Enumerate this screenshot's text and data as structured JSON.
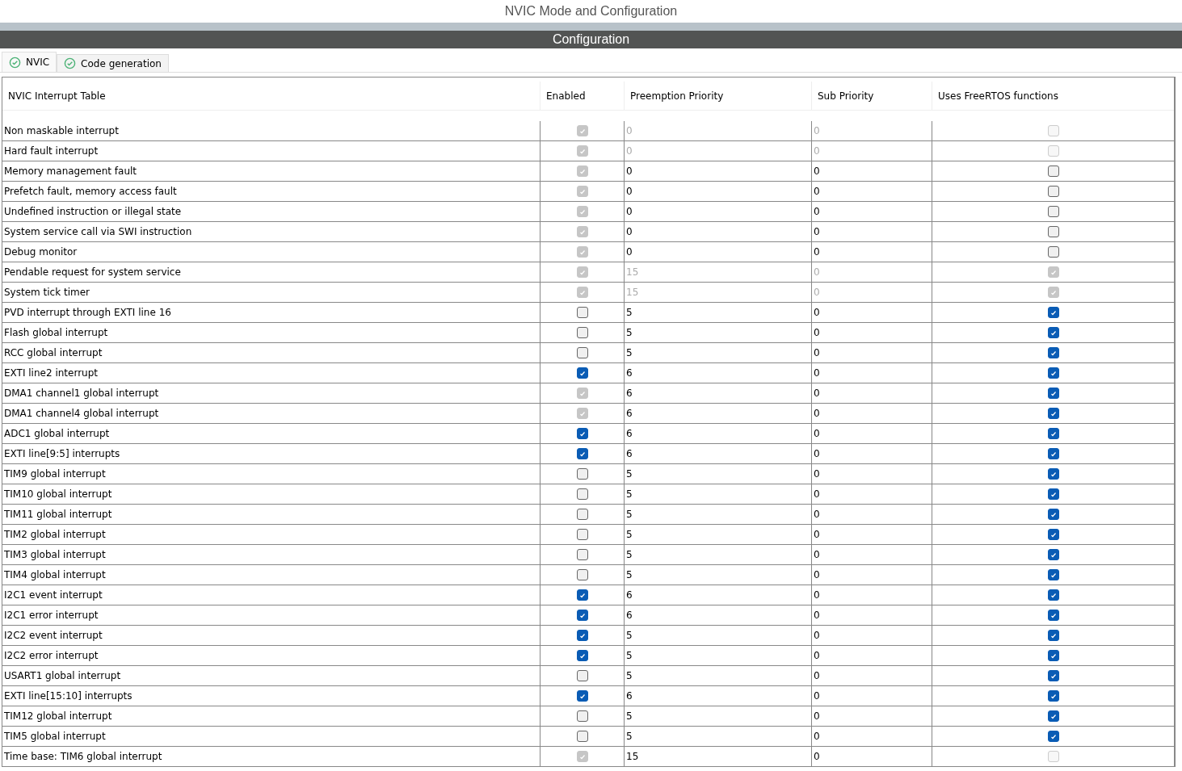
{
  "window": {
    "title": "NVIC Mode and Configuration"
  },
  "section": {
    "title": "Configuration"
  },
  "tabs": [
    {
      "label": "NVIC",
      "selected": true
    },
    {
      "label": "Code generation",
      "selected": false
    }
  ],
  "table": {
    "columns": [
      "NVIC Interrupt Table",
      "Enabled",
      "Preemption Priority",
      "Sub Priority",
      "Uses FreeRTOS functions"
    ],
    "rows": [
      {
        "name": "Non maskable interrupt",
        "enabled": {
          "checked": true,
          "disabled": true
        },
        "preemption": "0",
        "sub": "0",
        "priorities_disabled": true,
        "freertos": {
          "checked": false,
          "disabled": true
        }
      },
      {
        "name": "Hard fault interrupt",
        "enabled": {
          "checked": true,
          "disabled": true
        },
        "preemption": "0",
        "sub": "0",
        "priorities_disabled": true,
        "freertos": {
          "checked": false,
          "disabled": true
        }
      },
      {
        "name": "Memory management fault",
        "enabled": {
          "checked": true,
          "disabled": true
        },
        "preemption": "0",
        "sub": "0",
        "priorities_disabled": false,
        "freertos": {
          "checked": false,
          "disabled": false
        }
      },
      {
        "name": "Prefetch fault, memory access fault",
        "enabled": {
          "checked": true,
          "disabled": true
        },
        "preemption": "0",
        "sub": "0",
        "priorities_disabled": false,
        "freertos": {
          "checked": false,
          "disabled": false
        }
      },
      {
        "name": "Undefined instruction or illegal state",
        "enabled": {
          "checked": true,
          "disabled": true
        },
        "preemption": "0",
        "sub": "0",
        "priorities_disabled": false,
        "freertos": {
          "checked": false,
          "disabled": false
        }
      },
      {
        "name": "System service call via SWI instruction",
        "enabled": {
          "checked": true,
          "disabled": true
        },
        "preemption": "0",
        "sub": "0",
        "priorities_disabled": false,
        "freertos": {
          "checked": false,
          "disabled": false
        }
      },
      {
        "name": "Debug monitor",
        "enabled": {
          "checked": true,
          "disabled": true
        },
        "preemption": "0",
        "sub": "0",
        "priorities_disabled": false,
        "freertos": {
          "checked": false,
          "disabled": false
        }
      },
      {
        "name": "Pendable request for system service",
        "enabled": {
          "checked": true,
          "disabled": true
        },
        "preemption": "15",
        "sub": "0",
        "priorities_disabled": true,
        "freertos": {
          "checked": true,
          "disabled": true
        }
      },
      {
        "name": "System tick timer",
        "enabled": {
          "checked": true,
          "disabled": true
        },
        "preemption": "15",
        "sub": "0",
        "priorities_disabled": true,
        "freertos": {
          "checked": true,
          "disabled": true
        }
      },
      {
        "name": "PVD interrupt through EXTI line 16",
        "enabled": {
          "checked": false,
          "disabled": false
        },
        "preemption": "5",
        "sub": "0",
        "priorities_disabled": false,
        "freertos": {
          "checked": true,
          "disabled": false
        }
      },
      {
        "name": "Flash global interrupt",
        "enabled": {
          "checked": false,
          "disabled": false
        },
        "preemption": "5",
        "sub": "0",
        "priorities_disabled": false,
        "freertos": {
          "checked": true,
          "disabled": false
        }
      },
      {
        "name": "RCC global interrupt",
        "enabled": {
          "checked": false,
          "disabled": false
        },
        "preemption": "5",
        "sub": "0",
        "priorities_disabled": false,
        "freertos": {
          "checked": true,
          "disabled": false
        }
      },
      {
        "name": "EXTI line2 interrupt",
        "enabled": {
          "checked": true,
          "disabled": false
        },
        "preemption": "6",
        "sub": "0",
        "priorities_disabled": false,
        "freertos": {
          "checked": true,
          "disabled": false
        }
      },
      {
        "name": "DMA1 channel1 global interrupt",
        "enabled": {
          "checked": true,
          "disabled": true
        },
        "preemption": "6",
        "sub": "0",
        "priorities_disabled": false,
        "freertos": {
          "checked": true,
          "disabled": false
        }
      },
      {
        "name": "DMA1 channel4 global interrupt",
        "enabled": {
          "checked": true,
          "disabled": true
        },
        "preemption": "6",
        "sub": "0",
        "priorities_disabled": false,
        "freertos": {
          "checked": true,
          "disabled": false
        }
      },
      {
        "name": "ADC1 global interrupt",
        "enabled": {
          "checked": true,
          "disabled": false
        },
        "preemption": "6",
        "sub": "0",
        "priorities_disabled": false,
        "freertos": {
          "checked": true,
          "disabled": false
        }
      },
      {
        "name": "EXTI line[9:5] interrupts",
        "enabled": {
          "checked": true,
          "disabled": false
        },
        "preemption": "6",
        "sub": "0",
        "priorities_disabled": false,
        "freertos": {
          "checked": true,
          "disabled": false
        }
      },
      {
        "name": "TIM9 global interrupt",
        "enabled": {
          "checked": false,
          "disabled": false
        },
        "preemption": "5",
        "sub": "0",
        "priorities_disabled": false,
        "freertos": {
          "checked": true,
          "disabled": false
        }
      },
      {
        "name": "TIM10 global interrupt",
        "enabled": {
          "checked": false,
          "disabled": false
        },
        "preemption": "5",
        "sub": "0",
        "priorities_disabled": false,
        "freertos": {
          "checked": true,
          "disabled": false
        }
      },
      {
        "name": "TIM11 global interrupt",
        "enabled": {
          "checked": false,
          "disabled": false
        },
        "preemption": "5",
        "sub": "0",
        "priorities_disabled": false,
        "freertos": {
          "checked": true,
          "disabled": false
        }
      },
      {
        "name": "TIM2 global interrupt",
        "enabled": {
          "checked": false,
          "disabled": false
        },
        "preemption": "5",
        "sub": "0",
        "priorities_disabled": false,
        "freertos": {
          "checked": true,
          "disabled": false
        }
      },
      {
        "name": "TIM3 global interrupt",
        "enabled": {
          "checked": false,
          "disabled": false
        },
        "preemption": "5",
        "sub": "0",
        "priorities_disabled": false,
        "freertos": {
          "checked": true,
          "disabled": false
        }
      },
      {
        "name": "TIM4 global interrupt",
        "enabled": {
          "checked": false,
          "disabled": false
        },
        "preemption": "5",
        "sub": "0",
        "priorities_disabled": false,
        "freertos": {
          "checked": true,
          "disabled": false
        }
      },
      {
        "name": "I2C1 event interrupt",
        "enabled": {
          "checked": true,
          "disabled": false
        },
        "preemption": "6",
        "sub": "0",
        "priorities_disabled": false,
        "freertos": {
          "checked": true,
          "disabled": false
        }
      },
      {
        "name": "I2C1 error interrupt",
        "enabled": {
          "checked": true,
          "disabled": false
        },
        "preemption": "6",
        "sub": "0",
        "priorities_disabled": false,
        "freertos": {
          "checked": true,
          "disabled": false
        }
      },
      {
        "name": "I2C2 event interrupt",
        "enabled": {
          "checked": true,
          "disabled": false
        },
        "preemption": "5",
        "sub": "0",
        "priorities_disabled": false,
        "freertos": {
          "checked": true,
          "disabled": false
        }
      },
      {
        "name": "I2C2 error interrupt",
        "enabled": {
          "checked": true,
          "disabled": false
        },
        "preemption": "5",
        "sub": "0",
        "priorities_disabled": false,
        "freertos": {
          "checked": true,
          "disabled": false
        }
      },
      {
        "name": "USART1 global interrupt",
        "enabled": {
          "checked": false,
          "disabled": false
        },
        "preemption": "5",
        "sub": "0",
        "priorities_disabled": false,
        "freertos": {
          "checked": true,
          "disabled": false
        }
      },
      {
        "name": "EXTI line[15:10] interrupts",
        "enabled": {
          "checked": true,
          "disabled": false
        },
        "preemption": "6",
        "sub": "0",
        "priorities_disabled": false,
        "freertos": {
          "checked": true,
          "disabled": false
        }
      },
      {
        "name": "TIM12 global interrupt",
        "enabled": {
          "checked": false,
          "disabled": false
        },
        "preemption": "5",
        "sub": "0",
        "priorities_disabled": false,
        "freertos": {
          "checked": true,
          "disabled": false
        }
      },
      {
        "name": "TIM5 global interrupt",
        "enabled": {
          "checked": false,
          "disabled": false
        },
        "preemption": "5",
        "sub": "0",
        "priorities_disabled": false,
        "freertos": {
          "checked": true,
          "disabled": false
        }
      },
      {
        "name": "Time base: TIM6 global interrupt",
        "enabled": {
          "checked": true,
          "disabled": true
        },
        "preemption": "15",
        "sub": "0",
        "priorities_disabled": false,
        "freertos": {
          "checked": false,
          "disabled": true
        }
      }
    ]
  }
}
